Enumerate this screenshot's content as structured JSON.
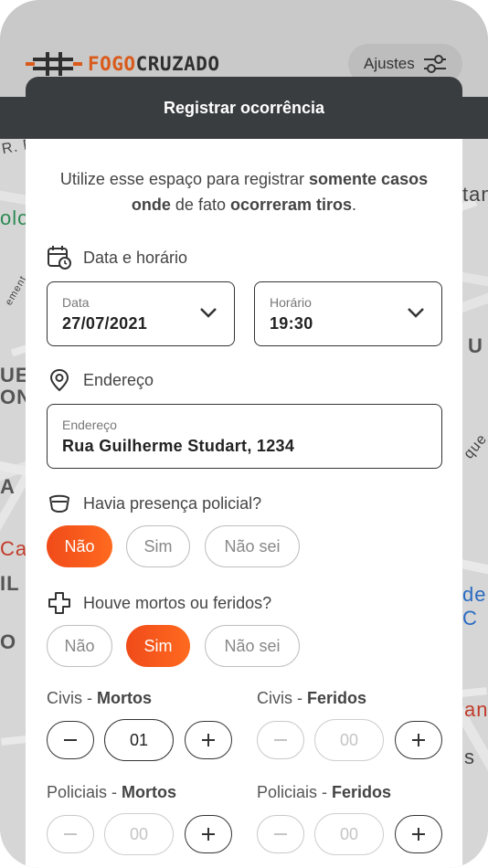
{
  "app": {
    "logo_part1": "FOGO",
    "logo_part2": "CRUZADO",
    "settings_label": "Ajustes"
  },
  "map_labels": {
    "l1": "R. Fl",
    "l2": "olo",
    "l3": "UE",
    "l4": "ON",
    "l5": "A",
    "l6": "Ca",
    "l7": "IL",
    "l8": "O",
    "l9": "tan",
    "l10": "U",
    "l11": "de C",
    "l12": "an",
    "l13": "s",
    "l14": "que",
    "l15": "ement"
  },
  "sheet": {
    "title": "Registrar ocorrência",
    "intro_1": "Utilize esse espaço para registrar ",
    "intro_2": "somente casos onde",
    "intro_3": " de fato ",
    "intro_4": "ocorreram tiros",
    "intro_5": "."
  },
  "datetime": {
    "section_label": "Data e horário",
    "date_label": "Data",
    "date_value": "27/07/2021",
    "time_label": "Horário",
    "time_value": "19:30"
  },
  "address": {
    "section_label": "Endereço",
    "field_label": "Endereço",
    "field_value": "Rua Guilherme Studart, 1234"
  },
  "police": {
    "question": "Havia presença policial?",
    "options": [
      "Não",
      "Sim",
      "Não sei"
    ],
    "selected": "Não"
  },
  "victims": {
    "question": "Houve mortos ou feridos?",
    "options": [
      "Não",
      "Sim",
      "Não sei"
    ],
    "selected": "Sim"
  },
  "counters": {
    "civil_prefix": "Civis - ",
    "police_prefix": "Policiais - ",
    "dead": "Mortos",
    "injured": "Feridos",
    "civil_dead": "01",
    "civil_injured": "00",
    "police_dead": "00",
    "police_injured": "00"
  },
  "colors": {
    "accent": "#f04b1a",
    "header": "#3a3d40"
  }
}
